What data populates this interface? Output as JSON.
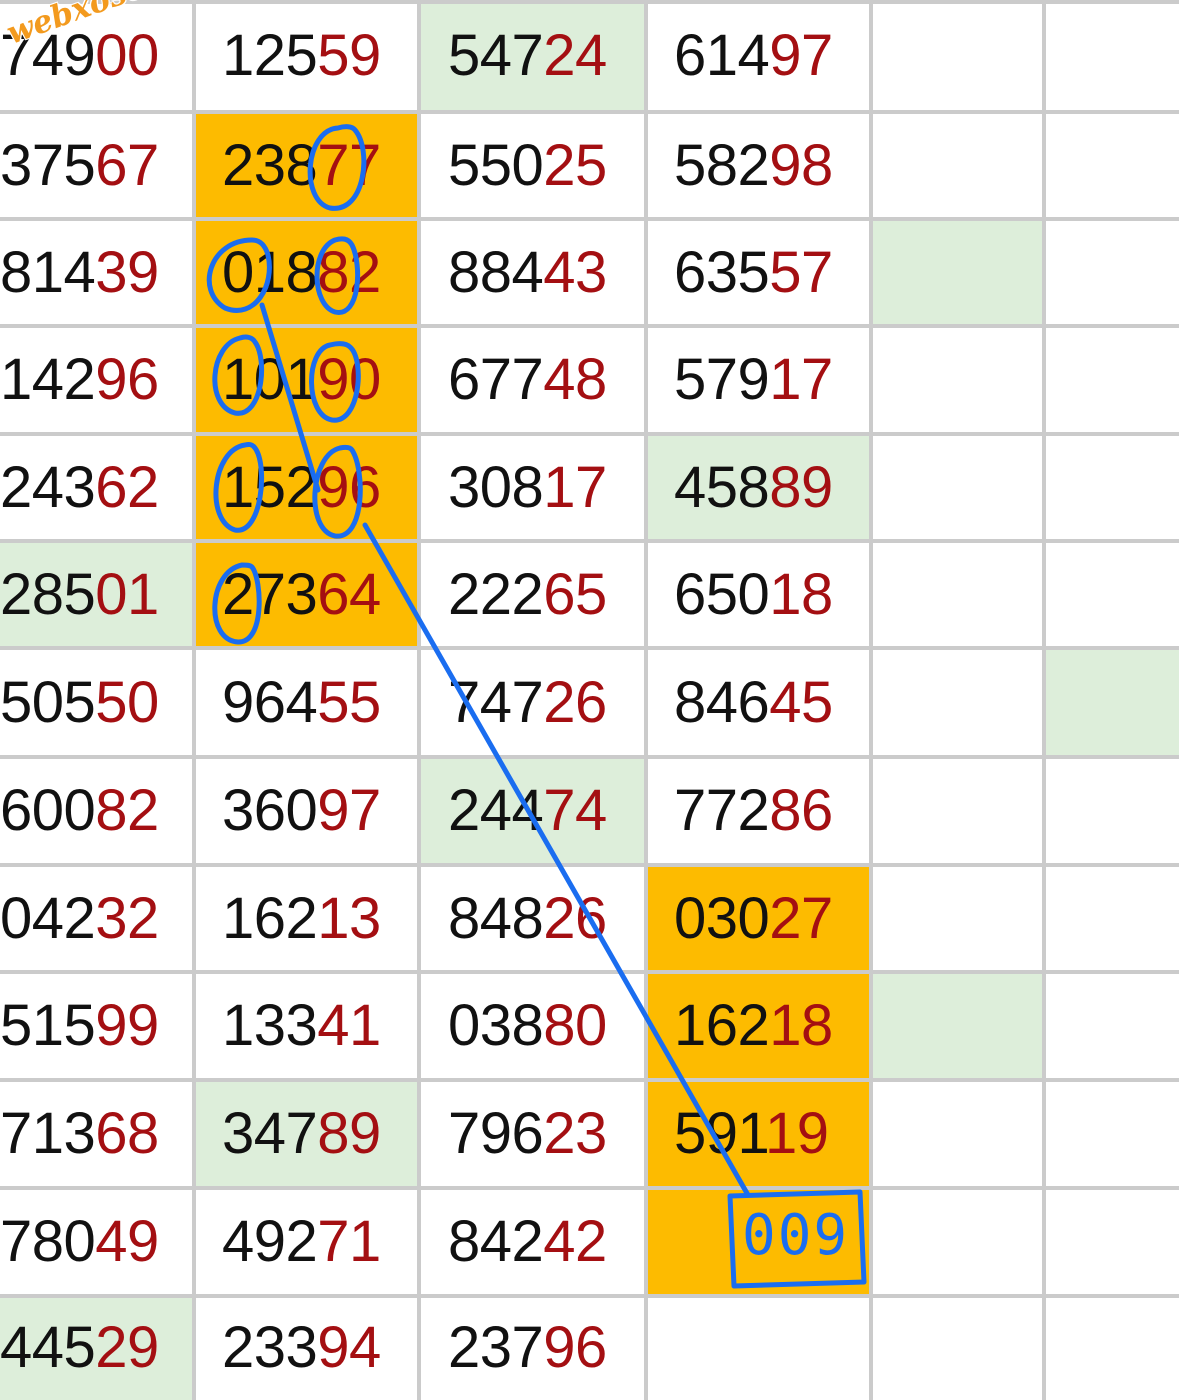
{
  "watermark": "webxoso.net",
  "colors": {
    "number_text": "#111111",
    "last_two_digits": "#a40f12",
    "highlight_orange": "#fdbb00",
    "highlight_green": "#ddeeda",
    "grid_line": "#cbcbcb",
    "pen_annotation": "#1a6df0"
  },
  "columns": [
    {
      "name": "col-1",
      "cells": [
        {
          "text": "74900",
          "bg": ""
        },
        {
          "text": "37567",
          "bg": ""
        },
        {
          "text": "81439",
          "bg": ""
        },
        {
          "text": "14296",
          "bg": ""
        },
        {
          "text": "24362",
          "bg": ""
        },
        {
          "text": "28501",
          "bg": "green"
        },
        {
          "text": "50550",
          "bg": ""
        },
        {
          "text": "60082",
          "bg": ""
        },
        {
          "text": "04232",
          "bg": ""
        },
        {
          "text": "51599",
          "bg": ""
        },
        {
          "text": "71368",
          "bg": ""
        },
        {
          "text": "78049",
          "bg": ""
        },
        {
          "text": "44529",
          "bg": "green"
        }
      ]
    },
    {
      "name": "col-2",
      "cells": [
        {
          "text": "12559",
          "bg": ""
        },
        {
          "text": "23877",
          "bg": "orange"
        },
        {
          "text": "01882",
          "bg": "orange"
        },
        {
          "text": "10190",
          "bg": "orange"
        },
        {
          "text": "15296",
          "bg": "orange"
        },
        {
          "text": "27364",
          "bg": "orange"
        },
        {
          "text": "96455",
          "bg": ""
        },
        {
          "text": "36097",
          "bg": ""
        },
        {
          "text": "16213",
          "bg": ""
        },
        {
          "text": "13341",
          "bg": ""
        },
        {
          "text": "34789",
          "bg": "green"
        },
        {
          "text": "49271",
          "bg": ""
        },
        {
          "text": "23394",
          "bg": ""
        }
      ]
    },
    {
      "name": "col-3",
      "cells": [
        {
          "text": "54724",
          "bg": "green"
        },
        {
          "text": "55025",
          "bg": ""
        },
        {
          "text": "88443",
          "bg": ""
        },
        {
          "text": "67748",
          "bg": ""
        },
        {
          "text": "30817",
          "bg": ""
        },
        {
          "text": "22265",
          "bg": ""
        },
        {
          "text": "74726",
          "bg": ""
        },
        {
          "text": "24474",
          "bg": "green"
        },
        {
          "text": "84826",
          "bg": ""
        },
        {
          "text": "03880",
          "bg": ""
        },
        {
          "text": "79623",
          "bg": ""
        },
        {
          "text": "84242",
          "bg": ""
        },
        {
          "text": "23796",
          "bg": ""
        }
      ]
    },
    {
      "name": "col-4",
      "cells": [
        {
          "text": "61497",
          "bg": ""
        },
        {
          "text": "58298",
          "bg": ""
        },
        {
          "text": "63557",
          "bg": ""
        },
        {
          "text": "57917",
          "bg": ""
        },
        {
          "text": "45889",
          "bg": "green"
        },
        {
          "text": "65018",
          "bg": ""
        },
        {
          "text": "84645",
          "bg": ""
        },
        {
          "text": "77286",
          "bg": ""
        },
        {
          "text": "03027",
          "bg": "orange"
        },
        {
          "text": "16218",
          "bg": "orange"
        },
        {
          "text": "59119",
          "bg": "orange"
        },
        {
          "text": "",
          "bg": "orange"
        },
        {
          "text": "",
          "bg": ""
        }
      ]
    },
    {
      "name": "col-5",
      "cells": [
        {
          "text": "",
          "bg": ""
        },
        {
          "text": "",
          "bg": ""
        },
        {
          "text": "",
          "bg": "green"
        },
        {
          "text": "",
          "bg": ""
        },
        {
          "text": "",
          "bg": ""
        },
        {
          "text": "",
          "bg": ""
        },
        {
          "text": "",
          "bg": ""
        },
        {
          "text": "",
          "bg": ""
        },
        {
          "text": "",
          "bg": ""
        },
        {
          "text": "",
          "bg": "green"
        },
        {
          "text": "",
          "bg": ""
        },
        {
          "text": "",
          "bg": ""
        },
        {
          "text": "",
          "bg": ""
        }
      ]
    },
    {
      "name": "col-6",
      "cells": [
        {
          "text": "",
          "bg": ""
        },
        {
          "text": "",
          "bg": ""
        },
        {
          "text": "",
          "bg": ""
        },
        {
          "text": "",
          "bg": ""
        },
        {
          "text": "",
          "bg": ""
        },
        {
          "text": "",
          "bg": ""
        },
        {
          "text": "",
          "bg": "green"
        },
        {
          "text": "",
          "bg": ""
        },
        {
          "text": "",
          "bg": ""
        },
        {
          "text": "",
          "bg": ""
        },
        {
          "text": "",
          "bg": ""
        },
        {
          "text": "",
          "bg": ""
        },
        {
          "text": "",
          "bg": ""
        }
      ]
    }
  ],
  "annotation": {
    "handwritten_note": "009",
    "icon": "pen-markup-icon"
  }
}
